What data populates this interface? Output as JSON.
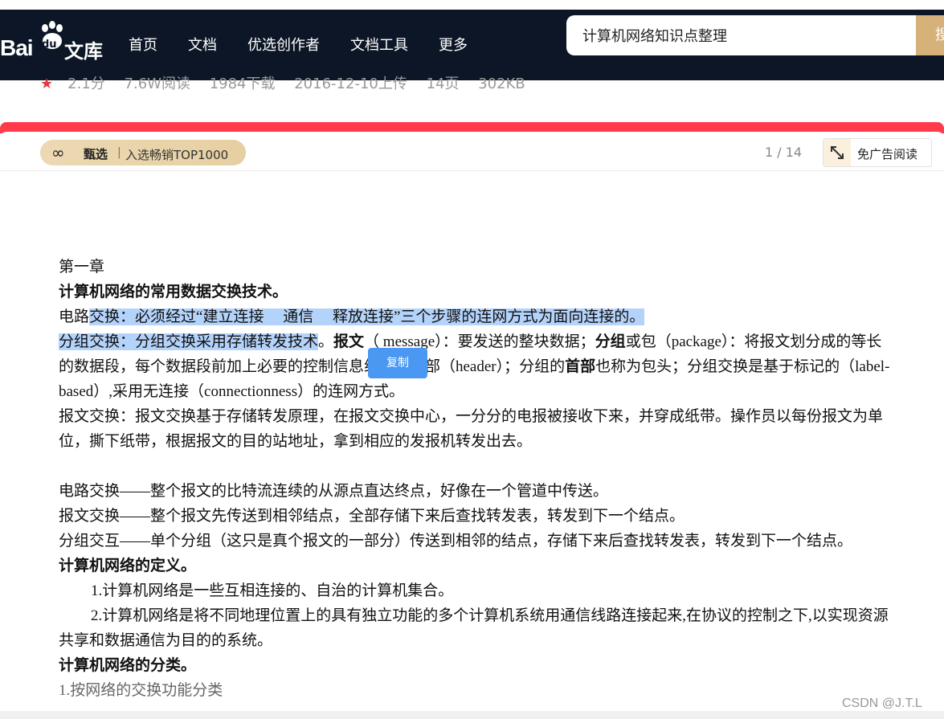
{
  "header": {
    "logo": {
      "bai": "Bai",
      "du": "du",
      "wenku": "文库"
    },
    "nav": [
      "首页",
      "文档",
      "优选创作者",
      "文档工具",
      "更多"
    ],
    "search": {
      "value": "计算机网络知识点整理",
      "button": "搜"
    },
    "bg_color": "#0c1626"
  },
  "meta": [
    "2.1分",
    "7.6W阅读",
    "1984下载",
    "2016-12-10上传",
    "14页",
    "302KB"
  ],
  "toolbar": {
    "badge_main": "甄选",
    "badge_sub": "入选畅销TOP1000",
    "page_count": "1 / 14",
    "noad_label": "免广告阅读"
  },
  "popup": {
    "copy": "复制"
  },
  "doc": {
    "ch_title": "第一章",
    "h1": "计算机网络的常用数据交换技术。",
    "p1_a": "电路",
    "p1_hl": "交换：必须经过“建立连接　 通信　 释放连接”三个步骤的连网方式为面向连接的。",
    "p2_hl": "分组交换：分组交换采用存储转发技术",
    "p2_dot": "。",
    "p2_b1": "报文",
    "p2_t1": "（ message）：要发送的整块数据；",
    "p2_b2": "分组",
    "p2_t2": "或包（package）：将报文划分成的等长的数据段，每个数据段前加上必要的控制信息组成的首部（header）；分组的",
    "p2_b3": "首部",
    "p2_t3": "也称为包头；分组交换是基于标记的（label-based）,采用无连接（connectionness）的连网方式。",
    "p3": "报文交换：报文交换基于存储转发原理，在报文交换中心，一分分的电报被接收下来，并穿成纸带。操作员以每份报文为单位，撕下纸带，根据报文的目的站地址，拿到相应的发报机转发出去。",
    "p4": "电路交换——整个报文的比特流连续的从源点直达终点，好像在一个管道中传送。",
    "p5": "报文交换——整个报文先传送到相邻结点，全部存储下来后查找转发表，转发到下一个结点。",
    "p6": "分组交互——单个分组（这只是真个报文的一部分）传送到相邻的结点，存储下来后查找转发表，转发到下一个结点。",
    "h2": "计算机网络的定义。",
    "def1": "1.计算机网络是一些互相连接的、自治的计算机集合。",
    "def2": "2.计算机网络是将不同地理位置上的具有独立功能的多个计算机系统用通信线路连接起来,在协议的控制之下,以实现资源共享和数据通信为目的的系统。",
    "h3": "计算机网络的分类。",
    "cut": "1.按网络的交换功能分类"
  },
  "watermark": "CSDN @J.T.L",
  "colors": {
    "accent_red": "#ff3a4b",
    "highlight": "#b4d3fb",
    "copy_blue": "#4b98f3",
    "search_gold": "#d6b27a"
  }
}
